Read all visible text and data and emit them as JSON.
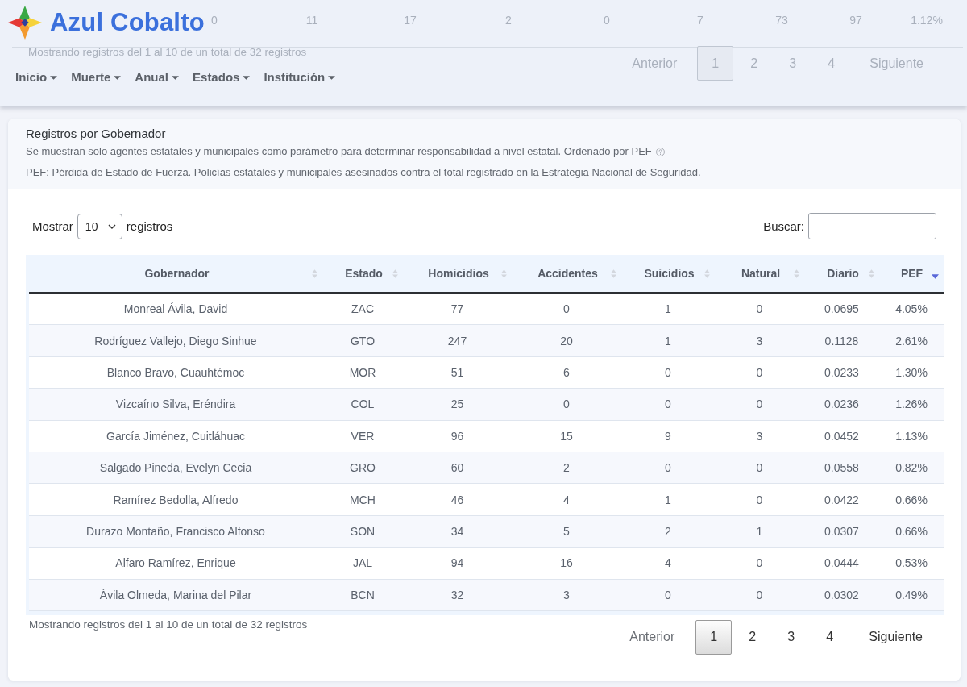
{
  "header": {
    "brand": "Azul Cobalto",
    "nav": [
      {
        "label": "Inicio",
        "dropdown": true
      },
      {
        "label": "Muerte",
        "dropdown": true
      },
      {
        "label": "Anual",
        "dropdown": true
      },
      {
        "label": "Estados",
        "dropdown": true
      },
      {
        "label": "Institución",
        "dropdown": true
      }
    ],
    "backdrop": {
      "row": [
        "0",
        "11",
        "17",
        "2",
        "0",
        "7",
        "73",
        "97",
        "1.12%"
      ],
      "info": "Mostrando registros del 1 al 10 de un total de 32 registros",
      "pagination": [
        {
          "label": "Anterior",
          "selected": false
        },
        {
          "label": "1",
          "selected": true
        },
        {
          "label": "2",
          "selected": false
        },
        {
          "label": "3",
          "selected": false
        },
        {
          "label": "4",
          "selected": false
        },
        {
          "label": "Siguiente",
          "selected": false
        }
      ]
    }
  },
  "panel": {
    "title": "Registros por Gobernador",
    "description": "Se muestran solo agentes estatales y municipales como parámetro para determinar responsabilidad a nivel estatal. Ordenado por PEF",
    "note": "PEF: Pérdida de Estado de Fuerza. Policías estatales y municipales asesinados contra el total registrado en la Estrategia Nacional de Seguridad."
  },
  "length_control": {
    "label_before": "Mostrar",
    "value": "10",
    "label_after": "registros"
  },
  "search": {
    "label": "Buscar:"
  },
  "table": {
    "columns": [
      {
        "label": "Gobernador",
        "sorted": false
      },
      {
        "label": "Estado",
        "sorted": false
      },
      {
        "label": "Homicidios",
        "sorted": false
      },
      {
        "label": "Accidentes",
        "sorted": false
      },
      {
        "label": "Suicidios",
        "sorted": false
      },
      {
        "label": "Natural",
        "sorted": false
      },
      {
        "label": "Diario",
        "sorted": false
      },
      {
        "label": "PEF",
        "sorted": true
      }
    ],
    "rows": [
      [
        "Monreal Ávila, David",
        "ZAC",
        "77",
        "0",
        "1",
        "0",
        "0.0695",
        "4.05%"
      ],
      [
        "Rodríguez Vallejo, Diego Sinhue",
        "GTO",
        "247",
        "20",
        "1",
        "3",
        "0.1128",
        "2.61%"
      ],
      [
        "Blanco Bravo, Cuauhtémoc",
        "MOR",
        "51",
        "6",
        "0",
        "0",
        "0.0233",
        "1.30%"
      ],
      [
        "Vizcaíno Silva, Eréndira",
        "COL",
        "25",
        "0",
        "0",
        "0",
        "0.0236",
        "1.26%"
      ],
      [
        "García Jiménez, Cuitláhuac",
        "VER",
        "96",
        "15",
        "9",
        "3",
        "0.0452",
        "1.13%"
      ],
      [
        "Salgado Pineda, Evelyn Cecia",
        "GRO",
        "60",
        "2",
        "0",
        "0",
        "0.0558",
        "0.82%"
      ],
      [
        "Ramírez Bedolla, Alfredo",
        "MCH",
        "46",
        "4",
        "1",
        "0",
        "0.0422",
        "0.66%"
      ],
      [
        "Durazo Montaño, Francisco Alfonso",
        "SON",
        "34",
        "5",
        "2",
        "1",
        "0.0307",
        "0.66%"
      ],
      [
        "Alfaro Ramírez, Enrique",
        "JAL",
        "94",
        "16",
        "4",
        "0",
        "0.0444",
        "0.53%"
      ],
      [
        "Ávila Olmeda, Marina del Pilar",
        "BCN",
        "32",
        "3",
        "0",
        "0",
        "0.0302",
        "0.49%"
      ]
    ]
  },
  "info": "Mostrando registros del 1 al 10 de un total de 32 registros",
  "pagination": [
    {
      "label": "Anterior",
      "kind": "prev",
      "selected": false,
      "disabled": true
    },
    {
      "label": "1",
      "kind": "page",
      "selected": true,
      "disabled": false
    },
    {
      "label": "2",
      "kind": "page",
      "selected": false,
      "disabled": false
    },
    {
      "label": "3",
      "kind": "page",
      "selected": false,
      "disabled": false
    },
    {
      "label": "4",
      "kind": "page",
      "selected": false,
      "disabled": false
    },
    {
      "label": "Siguiente",
      "kind": "next",
      "selected": false,
      "disabled": false
    }
  ]
}
